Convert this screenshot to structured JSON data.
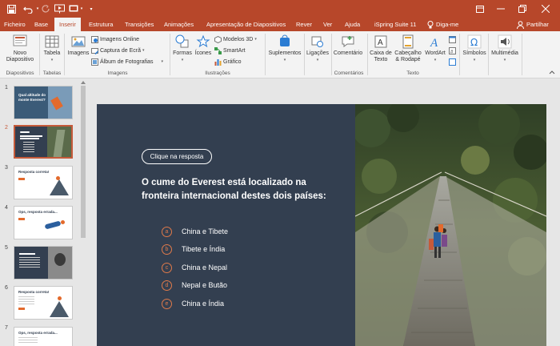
{
  "titlebar": {
    "customize_label": "▾",
    "window_controls": [
      "minimize",
      "restore",
      "close"
    ]
  },
  "tabs": [
    {
      "label": "Ficheiro",
      "active": false
    },
    {
      "label": "Base",
      "active": false
    },
    {
      "label": "Inserir",
      "active": true
    },
    {
      "label": "Estrutura",
      "active": false
    },
    {
      "label": "Transições",
      "active": false
    },
    {
      "label": "Animações",
      "active": false
    },
    {
      "label": "Apresentação de Diapositivos",
      "active": false
    },
    {
      "label": "Rever",
      "active": false
    },
    {
      "label": "Ver",
      "active": false
    },
    {
      "label": "Ajuda",
      "active": false
    },
    {
      "label": "iSpring Suite 11",
      "active": false
    }
  ],
  "tellme": "Diga-me",
  "share": "Partilhar",
  "ribbon": {
    "new_slide": "Novo Diapositivo",
    "table": "Tabela",
    "images": "Imagens",
    "online_images": "Imagens Online",
    "screenshot": "Captura de Ecrã",
    "photo_album": "Álbum de Fotografias",
    "shapes": "Formas",
    "icons": "Ícones",
    "models_3d": "Modelos 3D",
    "smartart": "SmartArt",
    "chart": "Gráfico",
    "addins": "Suplementos",
    "links": "Ligações",
    "comment": "Comentário",
    "textbox": "Caixa de Texto",
    "header_footer": "Cabeçalho & Rodapé",
    "wordart": "WordArt",
    "symbols": "Símbolos",
    "media": "Multimédia",
    "groups": {
      "slides": "Diapositivos",
      "tables": "Tabelas",
      "images": "Imagens",
      "illustrations": "Ilustrações",
      "comments": "Comentários",
      "text": "Texto"
    }
  },
  "thumbnails": [
    {
      "num": "1",
      "title": "Qual altitude do monte Everest?",
      "selected": false
    },
    {
      "num": "2",
      "title": "",
      "selected": true
    },
    {
      "num": "3",
      "title": "Resposta correta!",
      "selected": false
    },
    {
      "num": "4",
      "title": "Ops, resposta errada...",
      "selected": false
    },
    {
      "num": "5",
      "title": "",
      "selected": false
    },
    {
      "num": "6",
      "title": "Resposta correta!",
      "selected": false
    },
    {
      "num": "7",
      "title": "Ops, resposta errada...",
      "selected": false
    }
  ],
  "slide": {
    "reply_button": "Clique na resposta",
    "question": "O cume do Everest está localizado na fronteira internacional destes dois países:",
    "options": [
      {
        "letter": "a",
        "text": "China e Tibete"
      },
      {
        "letter": "b",
        "text": "Tibete e Índia"
      },
      {
        "letter": "c",
        "text": "China e Nepal"
      },
      {
        "letter": "d",
        "text": "Nepal e Butão"
      },
      {
        "letter": "e",
        "text": "China e Índia"
      }
    ]
  },
  "colors": {
    "accent": "#b7472a",
    "slide_bg": "#333f50",
    "option_accent": "#e07a4a"
  }
}
